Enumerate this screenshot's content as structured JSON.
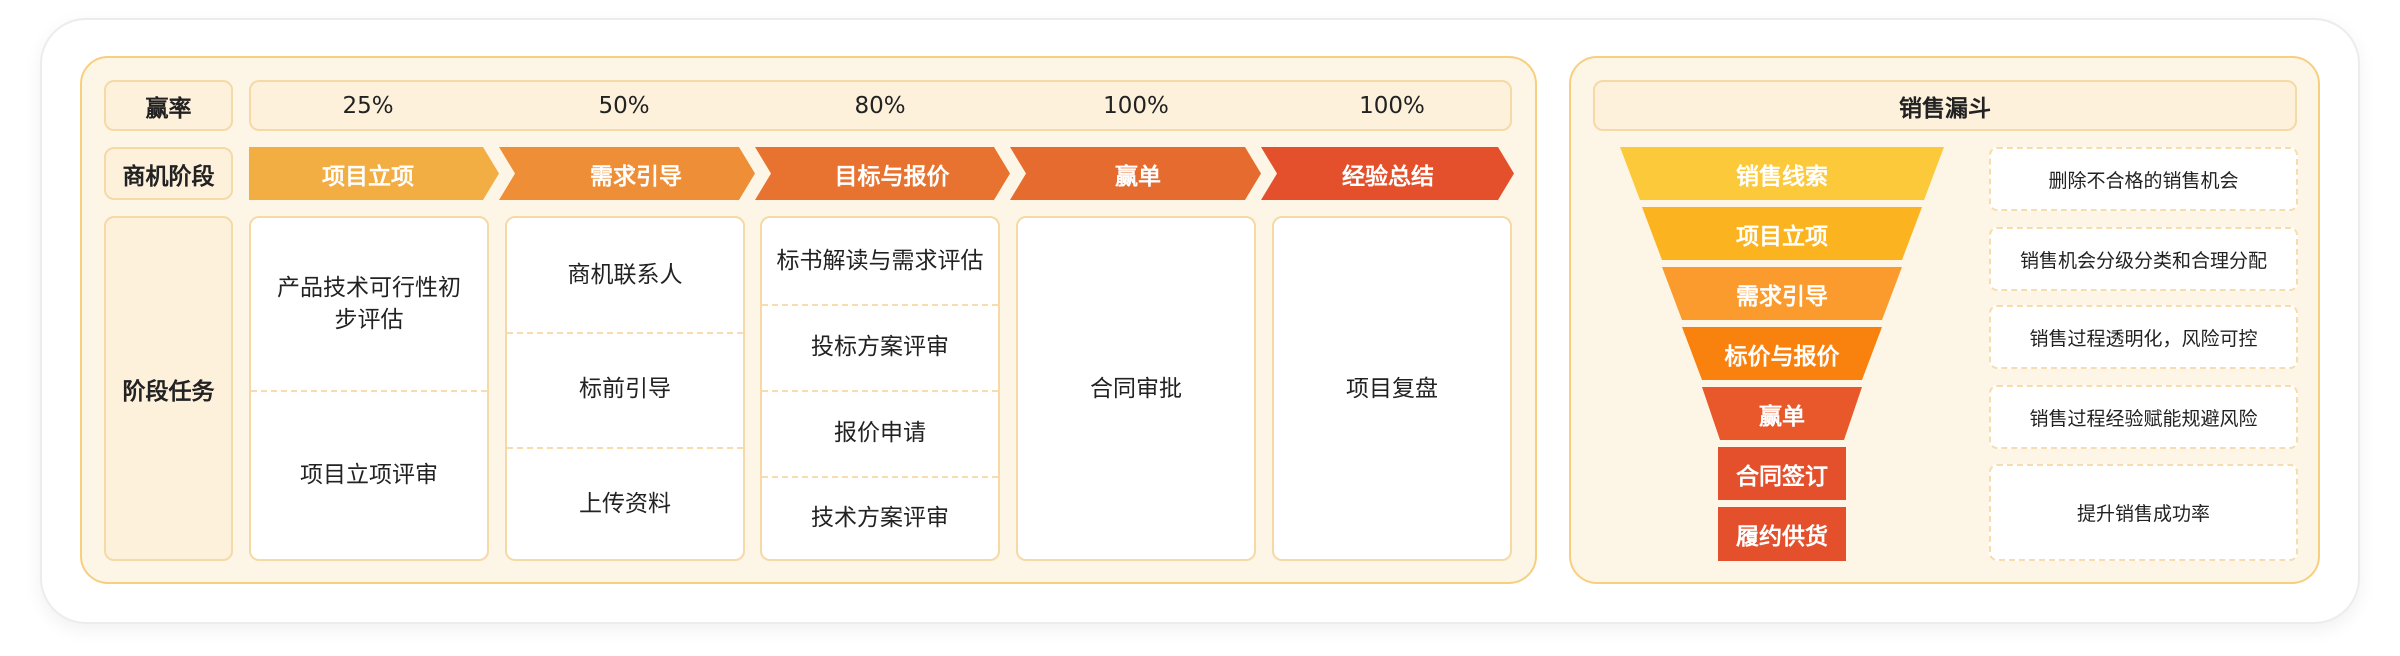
{
  "rows": {
    "rate_label": "赢率",
    "stage_label": "商机阶段",
    "task_label": "阶段任务"
  },
  "stages": [
    {
      "name": "项目立项",
      "rate": "25%",
      "color": "#f2ad43",
      "tasks": [
        "产品技术可行性初步评估",
        "项目立项评审"
      ]
    },
    {
      "name": "需求引导",
      "rate": "50%",
      "color": "#ee8f37",
      "tasks": [
        "商机联系人",
        "标前引导",
        "上传资料"
      ]
    },
    {
      "name": "目标与报价",
      "rate": "80%",
      "color": "#e8722f",
      "tasks": [
        "标书解读与需求评估",
        "投标方案评审",
        "报价申请",
        "技术方案评审"
      ]
    },
    {
      "name": "赢单",
      "rate": "100%",
      "color": "#e56b2e",
      "tasks": [
        "合同审批"
      ]
    },
    {
      "name": "经验总结",
      "rate": "100%",
      "color": "#e3502b",
      "tasks": [
        "项目复盘"
      ]
    }
  ],
  "funnel": {
    "title": "销售漏斗",
    "levels": [
      {
        "label": "销售线索",
        "color": "#fcc93a"
      },
      {
        "label": "项目立项",
        "color": "#fbb420"
      },
      {
        "label": "需求引导",
        "color": "#fb9b2e"
      },
      {
        "label": "标价与报价",
        "color": "#f9820f"
      },
      {
        "label": "赢单",
        "color": "#e8582a"
      },
      {
        "label": "合同签订",
        "color": "#e3502b"
      },
      {
        "label": "履约供货",
        "color": "#e3502b"
      }
    ],
    "descriptions": [
      "删除不合格的销售机会",
      "销售机会分级分类和合理分配",
      "销售过程透明化，风险可控",
      "销售过程经验赋能规避风险",
      "提升销售成功率"
    ]
  }
}
